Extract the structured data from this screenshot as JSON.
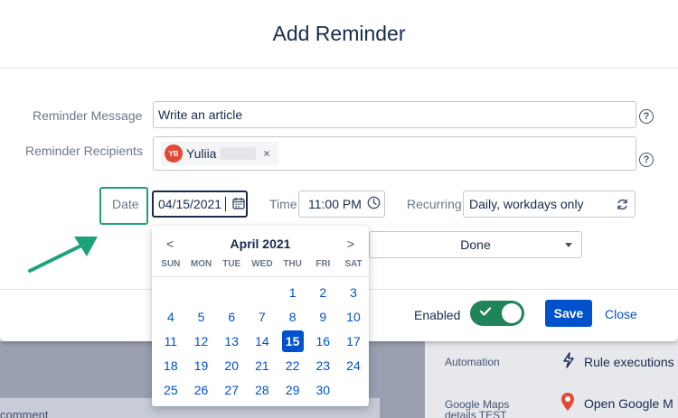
{
  "modal": {
    "title": "Add Reminder"
  },
  "form": {
    "message_label": "Reminder Message",
    "message_value": "Write an article",
    "recipients_label": "Reminder Recipients",
    "recipient": {
      "initials": "YB",
      "name": "Yuliia"
    },
    "date_label": "Date",
    "date_value": "04/15/2021",
    "time_label": "Time",
    "time_value": "11:00 PM",
    "recurring_label": "Recurring",
    "recurring_value": "Daily, workdays only",
    "status_value": "Done",
    "help_glyph": "?",
    "remove_glyph": "×"
  },
  "calendar": {
    "title": "April 2021",
    "prev": "<",
    "next": ">",
    "weekdays": [
      "SUN",
      "MON",
      "TUE",
      "WED",
      "THU",
      "FRI",
      "SAT"
    ],
    "leading_blanks": 4,
    "days": [
      "1",
      "2",
      "3",
      "4",
      "5",
      "6",
      "7",
      "8",
      "9",
      "10",
      "11",
      "12",
      "13",
      "14",
      "15",
      "16",
      "17",
      "18",
      "19",
      "20",
      "21",
      "22",
      "23",
      "24",
      "25",
      "26",
      "27",
      "28",
      "29",
      "30"
    ],
    "selected": "15"
  },
  "footer": {
    "enabled_label": "Enabled",
    "toggle_on": true,
    "save_label": "Save",
    "close_label": "Close"
  },
  "background": {
    "comment_text": "comment",
    "automation_label": "Automation",
    "rule_executions": "Rule executions",
    "maps_label": "Google Maps details TEST",
    "open_maps": "Open Google M"
  },
  "colors": {
    "primary": "#0052cc",
    "toggle": "#1f845a",
    "highlight": "#1aa37a",
    "avatar": "#e34935"
  },
  "icons": {
    "help": "help-icon",
    "calendar": "calendar-icon",
    "clock": "clock-icon",
    "recurring": "refresh-icon",
    "check": "check-icon",
    "remove": "close-icon",
    "lightning": "lightning-icon",
    "map_pin": "map-pin-icon"
  }
}
